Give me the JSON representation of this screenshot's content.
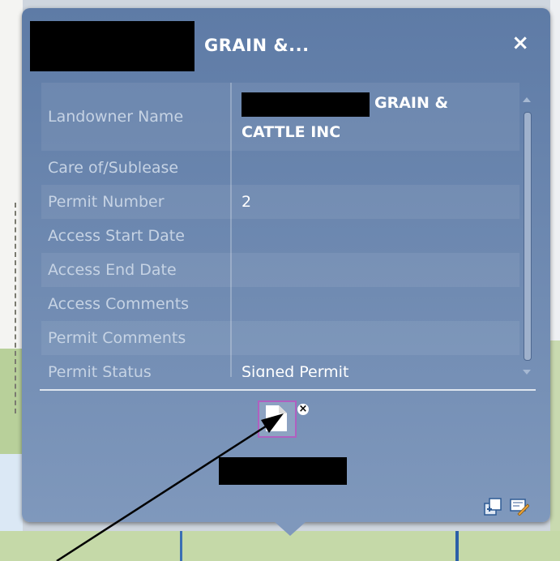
{
  "popup": {
    "title": "GRAIN &...",
    "close_symbol": "×",
    "attributes": [
      {
        "label": "Landowner Name",
        "value_line1": "GRAIN &",
        "value_line2": "CATTLE INC"
      },
      {
        "label": "Care of/Sublease",
        "value": ""
      },
      {
        "label": "Permit Number",
        "value": "2"
      },
      {
        "label": "Access Start Date",
        "value": ""
      },
      {
        "label": "Access End Date",
        "value": ""
      },
      {
        "label": "Access Comments",
        "value": ""
      },
      {
        "label": "Permit Comments",
        "value": ""
      },
      {
        "label": "Permit Status",
        "value": "Signed Permit"
      }
    ],
    "attachment": {
      "remove_symbol": "×"
    },
    "icons": [
      "zoom-to-icon",
      "edit-icon"
    ]
  }
}
